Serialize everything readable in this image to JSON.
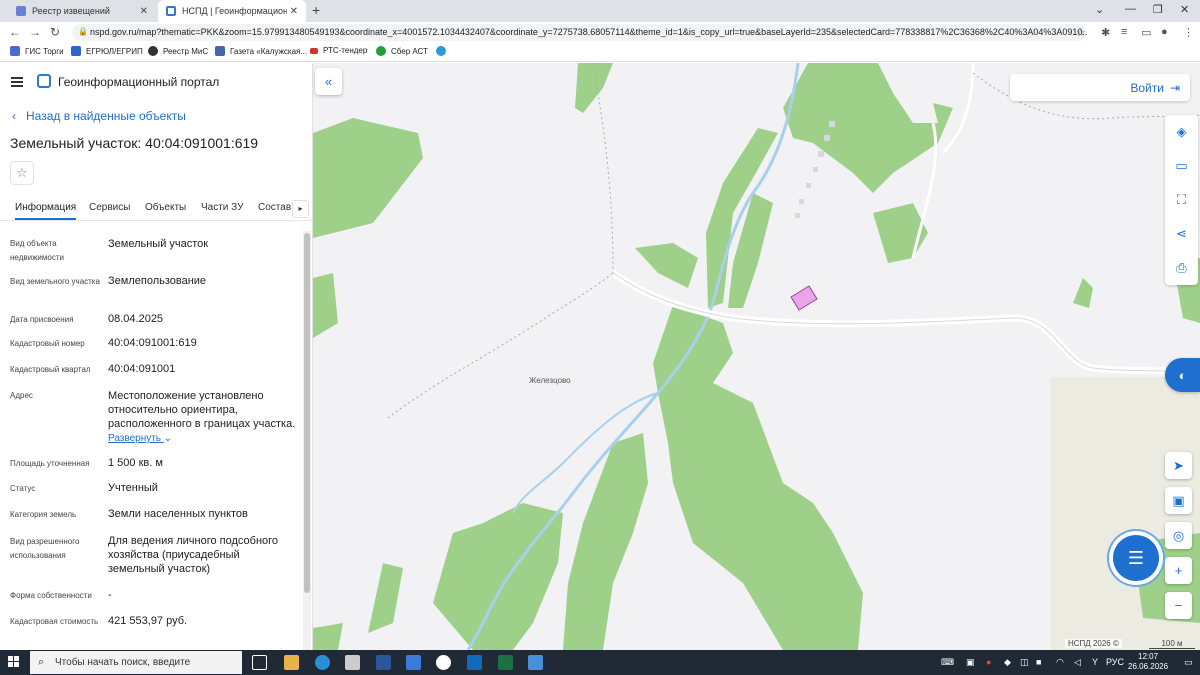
{
  "browser": {
    "tabs": [
      {
        "title": "Реестр извещений",
        "active": false
      },
      {
        "title": "НСПД | Геоинформационный п",
        "active": true
      }
    ],
    "url": "nspd.gov.ru/map?thematic=PKK&zoom=15.979913480549193&coordinate_x=4001572.1034432407&coordinate_y=7275738.68057114&theme_id=1&is_copy_url=true&baseLayerId=235&selectedCard=778338817%2C36368%2C40%3A04%3A0910...",
    "bookmarks": [
      {
        "label": "ГИС Торги",
        "color": "#4a6bd6"
      },
      {
        "label": "ЕГРЮЛ/ЕГРИП",
        "color": "#2c64c8"
      },
      {
        "label": "Реестр МиС",
        "color": "#333333"
      },
      {
        "label": "Газета «Калужская...",
        "color": "#4466aa"
      },
      {
        "label": "РТС-тендер",
        "color": "#d0342c"
      },
      {
        "label": "Сбер АСТ",
        "color": "#21a038"
      }
    ]
  },
  "panel": {
    "portal_title": "Геоинформационный портал",
    "back_label": "Назад в найденные объекты",
    "title": "Земельный участок: 40:04:091001:619",
    "tabs": [
      "Информация",
      "Сервисы",
      "Объекты",
      "Части ЗУ",
      "Состав"
    ],
    "fields": [
      {
        "label": "Вид объекта недвижимости",
        "value": "Земельный участок"
      },
      {
        "label": "Вид земельного участка",
        "value": "Землепользование"
      },
      {
        "label": "Дата присвоения",
        "value": "08.04.2025"
      },
      {
        "label": "Кадастровый номер",
        "value": "40:04:091001:619"
      },
      {
        "label": "Кадастровый квартал",
        "value": "40:04:091001"
      },
      {
        "label": "Адрес",
        "value": "Местоположение установлено относительно ориентира, расположенного в границах участка."
      },
      {
        "label": "Площадь уточненная",
        "value": "1 500 кв. м"
      },
      {
        "label": "Статус",
        "value": "Учтенный"
      },
      {
        "label": "Категория земель",
        "value": "Земли населенных пунктов"
      },
      {
        "label": "Вид разрешенного использования",
        "value": "Для ведения личного подсобного хозяйства (приусадебный земельный участок)"
      },
      {
        "label": "Форма собственности",
        "value": "-"
      },
      {
        "label": "Кадастровая стоимость",
        "value": "421 553,97 руб."
      }
    ],
    "expand_label": "Развернуть"
  },
  "map": {
    "login_label": "Войти",
    "place_label": "Железцово",
    "credits": "НСПД 2026 ©",
    "scale": "100 м",
    "colors": {
      "forest": "#9fd08a",
      "road": "#ffffff",
      "river": "#a9cfee",
      "parcel": "#e8a6e8"
    }
  },
  "taskbar": {
    "search_placeholder": "Чтобы начать поиск, введите",
    "lang": "РУС",
    "time": "12:07",
    "date": "26.06.2026"
  }
}
